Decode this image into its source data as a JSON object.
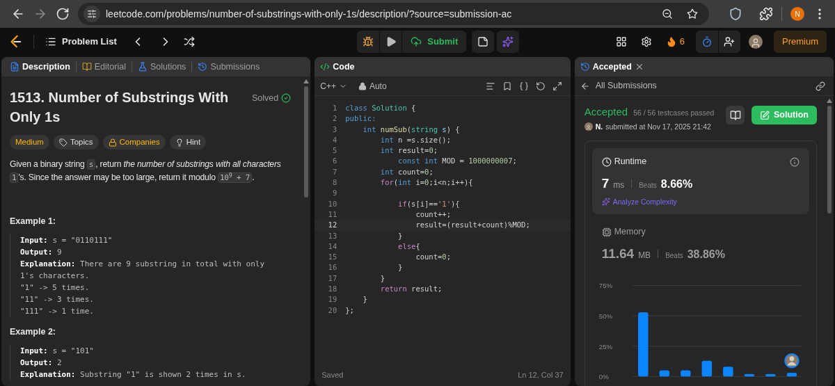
{
  "browser": {
    "url": "leetcode.com/problems/number-of-substrings-with-only-1s/description/?source=submission-ac",
    "profile_initial": "N"
  },
  "nav": {
    "problem_list": "Problem List",
    "submit": "Submit",
    "streak": "6",
    "premium": "Premium"
  },
  "description_panel": {
    "tabs": [
      {
        "label": "Description",
        "selected": true
      },
      {
        "label": "Editorial",
        "selected": false
      },
      {
        "label": "Solutions",
        "selected": false
      },
      {
        "label": "Submissions",
        "selected": false
      }
    ],
    "title": "1513. Number of Substrings With Only 1s",
    "status": "Solved",
    "tags": [
      {
        "kind": "difficulty",
        "label": "Medium"
      },
      {
        "kind": "topics",
        "label": "Topics"
      },
      {
        "kind": "companies",
        "label": "Companies"
      },
      {
        "kind": "hint",
        "label": "Hint"
      }
    ],
    "paragraph": [
      {
        "kind": "text",
        "text": "Given a binary string "
      },
      {
        "kind": "code",
        "text": "s"
      },
      {
        "kind": "text",
        "text": ", return *the number of substrings with all characters* "
      },
      {
        "kind": "code",
        "text": "1"
      },
      {
        "kind": "text",
        "text": "'s. Since the answer may be too large, return it modulo "
      },
      {
        "kind": "code",
        "text": "10$^{9}$ + 7"
      },
      {
        "kind": "text",
        "text": "."
      }
    ],
    "examples": [
      {
        "title": "Example 1:",
        "lines": [
          {
            "label": "Input:",
            "value": "s = \"0110111\""
          },
          {
            "label": "Output:",
            "value": "9"
          },
          {
            "label": "Explanation:",
            "value": "There are 9 substring in total with only"
          },
          {
            "value": "1's characters."
          },
          {
            "value": "\"1\" -> 5 times."
          },
          {
            "value": "\"11\" -> 3 times."
          },
          {
            "value": "\"111\" -> 1 time."
          }
        ]
      },
      {
        "title": "Example 2:",
        "lines": [
          {
            "label": "Input:",
            "value": "s = \"101\""
          },
          {
            "label": "Output:",
            "value": "2"
          },
          {
            "label": "Explanation:",
            "value": "Substring \"1\" is shown 2 times in s."
          }
        ]
      }
    ]
  },
  "code_panel": {
    "title": "Code",
    "language": "C++",
    "mode": "Auto",
    "status": "Saved",
    "cursor": "Ln 12, Col 37",
    "lines": [
      {
        "number": "1",
        "current": false,
        "tokens": [
          {
            "kind": "keyword",
            "text": "class"
          },
          {
            "kind": "type",
            "text": " Solution"
          },
          {
            "kind": "plain",
            "text": " {"
          }
        ]
      },
      {
        "number": "2",
        "current": false,
        "tokens": [
          {
            "kind": "keyword",
            "text": "public:"
          }
        ]
      },
      {
        "number": "3",
        "current": false,
        "tokens": [
          {
            "kind": "keyword",
            "text": "    int"
          },
          {
            "kind": "function",
            "text": " numSub"
          },
          {
            "kind": "plain",
            "text": "("
          },
          {
            "kind": "type",
            "text": "string"
          },
          {
            "kind": "variable",
            "text": " s"
          },
          {
            "kind": "plain",
            "text": ") {"
          }
        ]
      },
      {
        "number": "4",
        "current": false,
        "tokens": [
          {
            "kind": "keyword",
            "text": "        int"
          },
          {
            "kind": "plain",
            "text": " n =s.size();"
          }
        ]
      },
      {
        "number": "5",
        "current": false,
        "tokens": [
          {
            "kind": "keyword",
            "text": "        int"
          },
          {
            "kind": "plain",
            "text": " result="
          },
          {
            "kind": "number",
            "text": "0"
          },
          {
            "kind": "plain",
            "text": ";"
          }
        ]
      },
      {
        "number": "6",
        "current": false,
        "tokens": [
          {
            "kind": "keyword",
            "text": "            const int"
          },
          {
            "kind": "plain",
            "text": " MOD = "
          },
          {
            "kind": "number",
            "text": "1000000007"
          },
          {
            "kind": "plain",
            "text": ";"
          }
        ]
      },
      {
        "number": "7",
        "current": false,
        "tokens": [
          {
            "kind": "keyword",
            "text": "        int"
          },
          {
            "kind": "plain",
            "text": " count="
          },
          {
            "kind": "number",
            "text": "0"
          },
          {
            "kind": "plain",
            "text": ";"
          }
        ]
      },
      {
        "number": "8",
        "current": false,
        "tokens": [
          {
            "kind": "control",
            "text": "        for"
          },
          {
            "kind": "plain",
            "text": "("
          },
          {
            "kind": "keyword",
            "text": "int"
          },
          {
            "kind": "plain",
            "text": " i="
          },
          {
            "kind": "number",
            "text": "0"
          },
          {
            "kind": "plain",
            "text": ";i<n;i++){"
          }
        ]
      },
      {
        "number": "9",
        "current": false
      },
      {
        "number": "10",
        "current": false,
        "tokens": [
          {
            "kind": "control",
            "text": "            if"
          },
          {
            "kind": "plain",
            "text": "(s[i]=="
          },
          {
            "kind": "string",
            "text": "'1'"
          },
          {
            "kind": "plain",
            "text": "){"
          }
        ]
      },
      {
        "number": "11",
        "current": false,
        "tokens": [
          {
            "kind": "plain",
            "text": "                count++;"
          }
        ]
      },
      {
        "number": "12",
        "current": true,
        "tokens": [
          {
            "kind": "plain",
            "text": "                result=(result+count)%MOD;"
          }
        ]
      },
      {
        "number": "13",
        "current": false,
        "tokens": [
          {
            "kind": "plain",
            "text": "            }"
          }
        ]
      },
      {
        "number": "14",
        "current": false,
        "tokens": [
          {
            "kind": "control",
            "text": "            else"
          },
          {
            "kind": "plain",
            "text": "{"
          }
        ]
      },
      {
        "number": "15",
        "current": false,
        "tokens": [
          {
            "kind": "plain",
            "text": "                count="
          },
          {
            "kind": "number",
            "text": "0"
          },
          {
            "kind": "plain",
            "text": ";"
          }
        ]
      },
      {
        "number": "16",
        "current": false,
        "tokens": [
          {
            "kind": "plain",
            "text": "            }"
          }
        ]
      },
      {
        "number": "17",
        "current": false,
        "tokens": [
          {
            "kind": "plain",
            "text": "        }"
          }
        ]
      },
      {
        "number": "18",
        "current": false,
        "tokens": [
          {
            "kind": "control",
            "text": "        return"
          },
          {
            "kind": "plain",
            "text": " result;"
          }
        ]
      },
      {
        "number": "19",
        "current": false,
        "tokens": [
          {
            "kind": "plain",
            "text": "    }"
          }
        ]
      },
      {
        "number": "20",
        "current": false,
        "tokens": [
          {
            "kind": "plain",
            "text": "};"
          }
        ]
      }
    ]
  },
  "result_panel": {
    "tab": "Accepted",
    "back": "All Submissions",
    "verdict": "Accepted",
    "testcases": "56 / 56 testcases passed",
    "author": "N.",
    "submitted": "submitted at Nov 17, 2025 21:42",
    "solution": "Solution",
    "runtime": {
      "label": "Runtime",
      "value": "7",
      "unit": "ms",
      "beats_label": "Beats",
      "beats": "8.66%",
      "analyze": "Analyze Complexity"
    },
    "memory": {
      "label": "Memory",
      "value": "11.64",
      "unit": "MB",
      "beats_label": "Beats",
      "beats": "38.86%"
    },
    "chart_data": {
      "type": "bar",
      "grid": true,
      "ylim": [
        0,
        75
      ],
      "values": [
        53,
        5,
        5,
        13,
        8,
        2,
        2,
        3
      ],
      "yticks": [
        {
          "value": 0,
          "label": "0%"
        },
        {
          "value": 25,
          "label": "25%"
        },
        {
          "value": 50,
          "label": "50%"
        },
        {
          "value": 75,
          "label": "75%"
        }
      ]
    }
  }
}
